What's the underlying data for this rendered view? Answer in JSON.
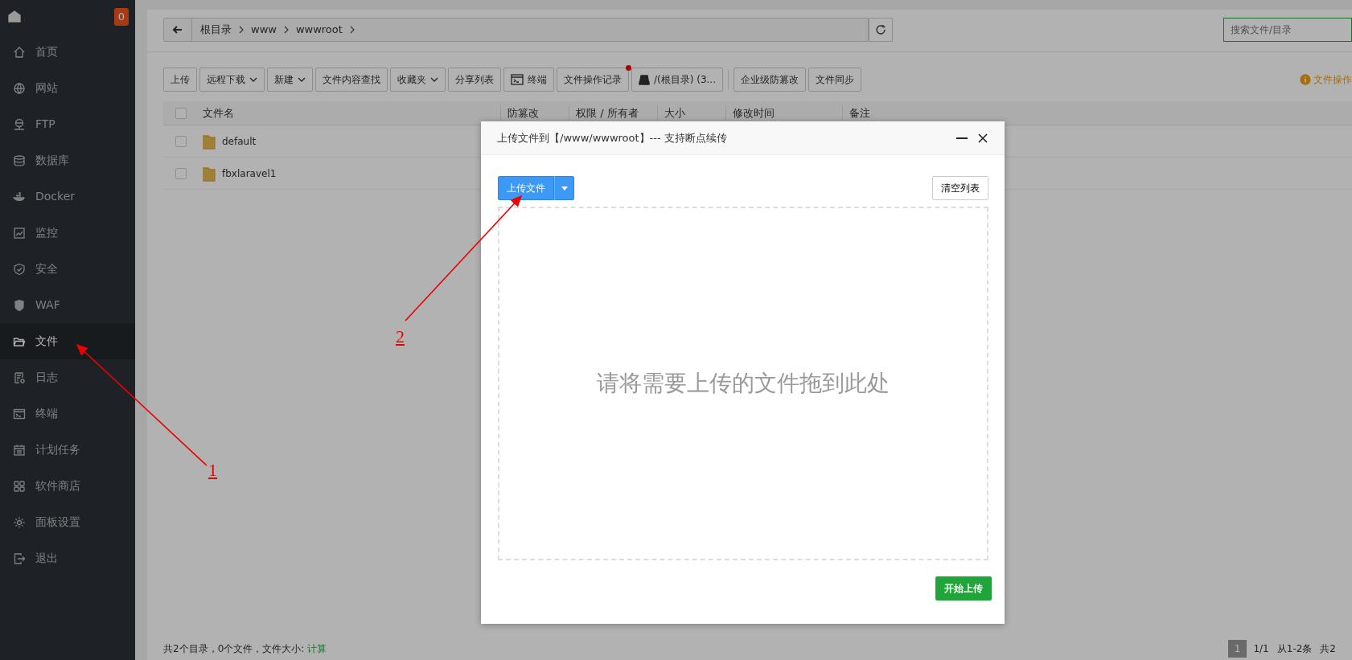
{
  "sidebar": {
    "badge": "0",
    "items": [
      {
        "label": "首页",
        "selected": false
      },
      {
        "label": "网站",
        "selected": false
      },
      {
        "label": "FTP",
        "selected": false
      },
      {
        "label": "数据库",
        "selected": false
      },
      {
        "label": "Docker",
        "selected": false
      },
      {
        "label": "监控",
        "selected": false
      },
      {
        "label": "安全",
        "selected": false
      },
      {
        "label": "WAF",
        "selected": false
      },
      {
        "label": "文件",
        "selected": true
      },
      {
        "label": "日志",
        "selected": false
      },
      {
        "label": "终端",
        "selected": false
      },
      {
        "label": "计划任务",
        "selected": false
      },
      {
        "label": "软件商店",
        "selected": false
      },
      {
        "label": "面板设置",
        "selected": false
      },
      {
        "label": "退出",
        "selected": false
      }
    ]
  },
  "breadcrumb": [
    "根目录",
    "www",
    "wwwroot"
  ],
  "search": {
    "placeholder": "搜索文件/目录"
  },
  "toolbar": [
    {
      "label": "上传",
      "kind": "plain"
    },
    {
      "label": "远程下载",
      "kind": "dropdown"
    },
    {
      "label": "新建",
      "kind": "dropdown"
    },
    {
      "label": "文件内容查找",
      "kind": "plain"
    },
    {
      "label": "收藏夹",
      "kind": "dropdown"
    },
    {
      "label": "分享列表",
      "kind": "plain"
    },
    {
      "label": "终端",
      "kind": "terminal"
    },
    {
      "label": "文件操作记录",
      "kind": "dot"
    },
    {
      "label": "/(根目录) (3...",
      "kind": "disk"
    },
    {
      "label": "企业级防篡改",
      "kind": "plain"
    },
    {
      "label": "文件同步",
      "kind": "plain"
    }
  ],
  "notice": "文件操作",
  "table": {
    "columns": [
      "文件名",
      "防篡改",
      "权限 / 所有者",
      "大小",
      "修改时间",
      "备注"
    ],
    "select_all_checked": false,
    "rows": [
      {
        "name": "default",
        "checked": false
      },
      {
        "name": "fbxlaravel1",
        "checked": false
      }
    ]
  },
  "footer": {
    "summary": "共2个目录，0个文件，文件大小:",
    "link": "计算",
    "page": "1",
    "pages": "1/1",
    "range": "从1-2条",
    "total": "共2"
  },
  "modal": {
    "title": "上传文件到【/www/wwwroot】--- 支持断点续传",
    "upload_button": "上传文件",
    "clear_button": "清空列表",
    "drop_hint": "请将需要上传的文件拖到此处",
    "start_button": "开始上传"
  },
  "annotations": [
    {
      "label": "1"
    },
    {
      "label": "2"
    }
  ]
}
